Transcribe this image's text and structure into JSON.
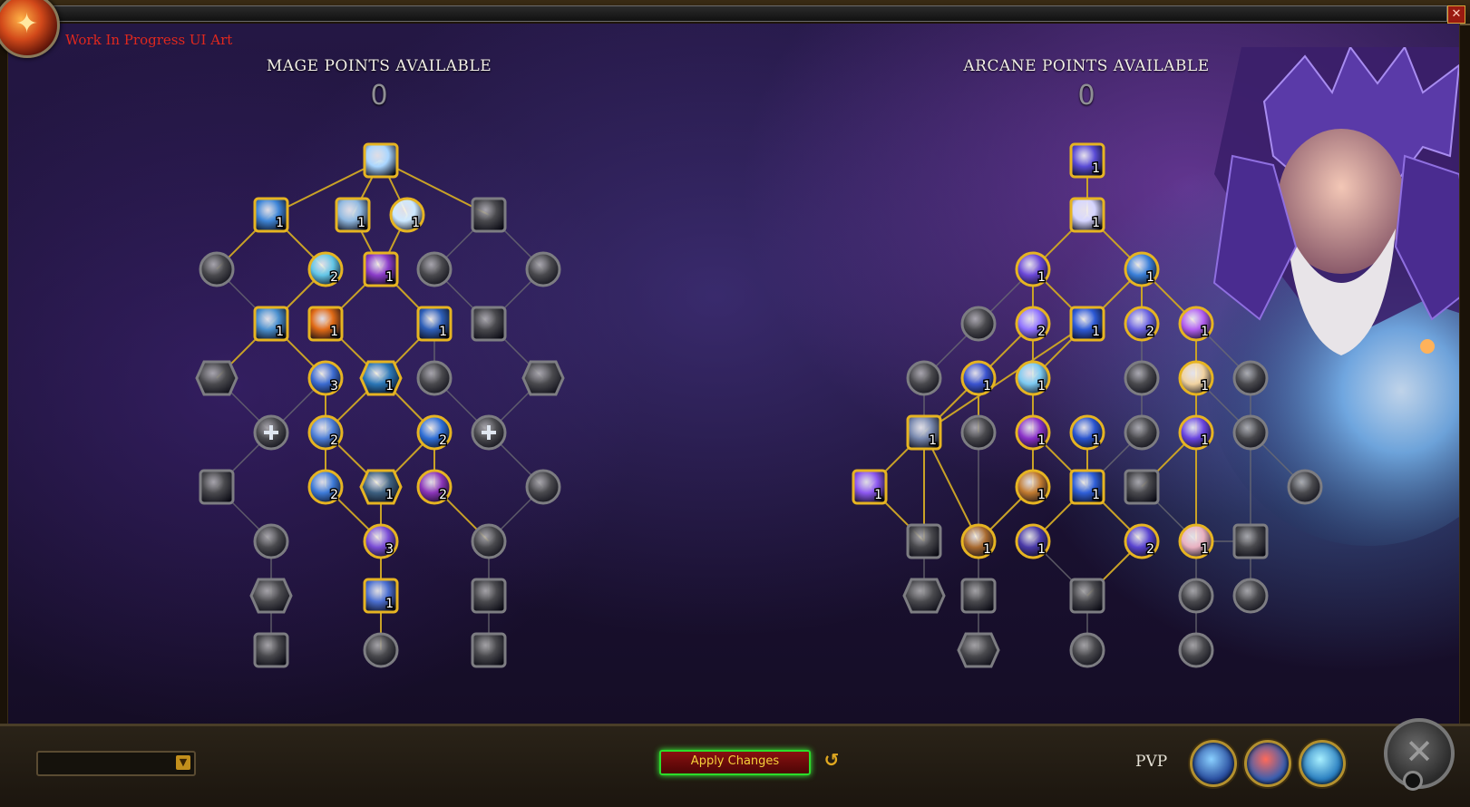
{
  "window": {
    "close_label": "✕"
  },
  "banner": {
    "wip_text": "Work In Progress UI Art"
  },
  "mage_tree": {
    "header": "Mage Points Available",
    "points": "0"
  },
  "arcane_tree": {
    "header": "Arcane Points Available",
    "points": "0"
  },
  "footer": {
    "apply_label": "Apply Changes",
    "undo_icon": "↺",
    "pvp_label": "PVP",
    "loadout_arrow": "▼",
    "close_x": "✕"
  },
  "colors": {
    "gold": "#e6b422",
    "gold_line": "#c9a227",
    "inactive_ring": "#7d7d82",
    "inactive_line": "#6d6d73",
    "points_text": "#8f8f94",
    "wip_red": "#e0281e",
    "apply_glow": "#39ff39"
  },
  "nodes": [
    {
      "id": "m1",
      "shape": "square",
      "active": true,
      "rank": "",
      "icon": "ice-barrier-icon",
      "color": "#a9d6ff"
    },
    {
      "id": "m2",
      "shape": "square",
      "active": true,
      "rank": "1",
      "icon": "ice-shard-icon",
      "color": "#3f86d8"
    },
    {
      "id": "m3",
      "shape": "square",
      "active": true,
      "rank": "1",
      "icon": "frost-armor-icon",
      "color": "#8fb8e0"
    },
    {
      "id": "m4",
      "shape": "circle",
      "active": true,
      "rank": "1",
      "icon": "blink-flash-icon",
      "color": "#cde9ff"
    },
    {
      "id": "m5",
      "shape": "square",
      "active": false,
      "rank": "",
      "icon": "mirror-image-icon",
      "color": "#4aa0b8"
    },
    {
      "id": "m6",
      "shape": "circle",
      "active": false,
      "rank": "",
      "icon": "frost-nova-icon",
      "color": "#5b84c9"
    },
    {
      "id": "m7",
      "shape": "circle",
      "active": true,
      "rank": "2",
      "icon": "time-rune-icon",
      "color": "#62c5e6"
    },
    {
      "id": "m8",
      "shape": "square",
      "active": true,
      "rank": "1",
      "icon": "arcane-shift-icon",
      "color": "#8b3cc9"
    },
    {
      "id": "m9",
      "shape": "circle",
      "active": false,
      "rank": "",
      "icon": "clock-icon",
      "color": "#666"
    },
    {
      "id": "m10",
      "shape": "circle",
      "active": false,
      "rank": "",
      "icon": "dragon-breath-icon",
      "color": "#555"
    },
    {
      "id": "m11",
      "shape": "square",
      "active": true,
      "rank": "1",
      "icon": "frost-giant-icon",
      "color": "#4a90cf"
    },
    {
      "id": "m12",
      "shape": "square",
      "active": true,
      "rank": "1",
      "icon": "fire-ward-icon",
      "color": "#e06a16"
    },
    {
      "id": "m13",
      "shape": "square",
      "active": true,
      "rank": "1",
      "icon": "ice-cold-icon",
      "color": "#2e5fb8"
    },
    {
      "id": "m14",
      "shape": "square",
      "active": false,
      "rank": "",
      "icon": "spellsteal-icon",
      "color": "#777"
    },
    {
      "id": "m15",
      "shape": "choice",
      "active": false,
      "rank": "",
      "icon": "incantation-icon",
      "color": "#5a6a9a"
    },
    {
      "id": "m16",
      "shape": "circle",
      "active": true,
      "rank": "3",
      "icon": "frigid-winds-icon",
      "color": "#3b6bd0"
    },
    {
      "id": "m17",
      "shape": "choice",
      "active": true,
      "rank": "1",
      "icon": "ice-floes-icon",
      "color": "#2a76b6"
    },
    {
      "id": "m18",
      "shape": "circle",
      "active": false,
      "rank": "",
      "icon": "tempest-barrier-icon",
      "color": "#666"
    },
    {
      "id": "m19",
      "shape": "choice",
      "active": false,
      "rank": "",
      "icon": "ring-of-frost-icon",
      "color": "#666"
    },
    {
      "id": "m20",
      "shape": "circle",
      "active": false,
      "rank": "",
      "icon": "plus-icon",
      "color": "#5a7ba6"
    },
    {
      "id": "m21",
      "shape": "circle",
      "active": true,
      "rank": "2",
      "icon": "ice-ward-icon",
      "color": "#4d7fd8"
    },
    {
      "id": "m22",
      "shape": "circle",
      "active": true,
      "rank": "2",
      "icon": "cold-snap-icon",
      "color": "#2f6fd6"
    },
    {
      "id": "m23",
      "shape": "circle",
      "active": false,
      "rank": "",
      "icon": "plus-icon",
      "color": "#777"
    },
    {
      "id": "m24",
      "shape": "square",
      "active": false,
      "rank": "",
      "icon": "slow-icon",
      "color": "#666"
    },
    {
      "id": "m25",
      "shape": "circle",
      "active": true,
      "rank": "2",
      "icon": "winters-protection-icon",
      "color": "#3d7ad8"
    },
    {
      "id": "m26",
      "shape": "choice",
      "active": true,
      "rank": "1",
      "icon": "shifting-power-icon",
      "color": "#3c5f7f"
    },
    {
      "id": "m27",
      "shape": "circle",
      "active": true,
      "rank": "2",
      "icon": "overflowing-energy-icon",
      "color": "#8a34b8"
    },
    {
      "id": "m28",
      "shape": "circle",
      "active": false,
      "rank": "",
      "icon": "rune-of-power-icon",
      "color": "#666"
    },
    {
      "id": "m29",
      "shape": "circle",
      "active": false,
      "rank": "",
      "icon": "frozen-touch-icon",
      "color": "#5fa1c9"
    },
    {
      "id": "m30",
      "shape": "circle",
      "active": true,
      "rank": "3",
      "icon": "arcane-orb-icon",
      "color": "#7a4dd6"
    },
    {
      "id": "m31",
      "shape": "circle",
      "active": false,
      "rank": "",
      "icon": "displacement-icon",
      "color": "#7c4dbb"
    },
    {
      "id": "m32",
      "shape": "choice",
      "active": false,
      "rank": "",
      "icon": "greater-invisibility-icon",
      "color": "#666"
    },
    {
      "id": "m33",
      "shape": "square",
      "active": true,
      "rank": "1",
      "icon": "temporal-warp-icon",
      "color": "#4b6fd0"
    },
    {
      "id": "m34",
      "shape": "square",
      "active": false,
      "rank": "",
      "icon": "dragons-breath-icon",
      "color": "#666"
    },
    {
      "id": "m35",
      "shape": "square",
      "active": false,
      "rank": "",
      "icon": "freezing-cold-icon",
      "color": "#777"
    },
    {
      "id": "m36",
      "shape": "circle",
      "active": false,
      "rank": "",
      "icon": "time-manipulation-icon",
      "color": "#7c3fb0"
    },
    {
      "id": "m37",
      "shape": "square",
      "active": false,
      "rank": "",
      "icon": "meteor-icon",
      "color": "#777"
    },
    {
      "id": "a1",
      "shape": "square",
      "active": true,
      "rank": "1",
      "icon": "arcane-missile-icon",
      "color": "#5a4cd6"
    },
    {
      "id": "a2",
      "shape": "square",
      "active": true,
      "rank": "1",
      "icon": "arcane-explosion-icon",
      "color": "#d5d5ff"
    },
    {
      "id": "a3",
      "shape": "circle",
      "active": true,
      "rank": "1",
      "icon": "arcane-surge-icon",
      "color": "#6b48d8"
    },
    {
      "id": "a4",
      "shape": "circle",
      "active": true,
      "rank": "1",
      "icon": "evocation-icon",
      "color": "#3a7fd8"
    },
    {
      "id": "a5",
      "shape": "circle",
      "active": false,
      "rank": "",
      "icon": "nether-tempest-icon",
      "color": "#5b3fa5"
    },
    {
      "id": "a6",
      "shape": "circle",
      "active": true,
      "rank": "2",
      "icon": "arcane-echo-icon",
      "color": "#8f72ff"
    },
    {
      "id": "a7",
      "shape": "square",
      "active": true,
      "rank": "1",
      "icon": "arcane-lightning-icon",
      "color": "#2d5ad6"
    },
    {
      "id": "a8",
      "shape": "circle",
      "active": true,
      "rank": "2",
      "icon": "arcane-harmony-icon",
      "color": "#6b63e0"
    },
    {
      "id": "a9",
      "shape": "circle",
      "active": true,
      "rank": "1",
      "icon": "arcane-bombardment-icon",
      "color": "#b25ef0"
    },
    {
      "id": "a10",
      "shape": "circle",
      "active": false,
      "rank": "",
      "icon": "boot-icon",
      "color": "#666"
    },
    {
      "id": "a11",
      "shape": "circle",
      "active": true,
      "rank": "1",
      "icon": "arcane-tempo-icon",
      "color": "#3a53cf"
    },
    {
      "id": "a12",
      "shape": "circle",
      "active": true,
      "rank": "1",
      "icon": "arcane-familiar-icon",
      "color": "#7cc9f0"
    },
    {
      "id": "a13",
      "shape": "circle",
      "active": false,
      "rank": "",
      "icon": "chrono-shift-icon",
      "color": "#3f5fd0"
    },
    {
      "id": "a14",
      "shape": "circle",
      "active": true,
      "rank": "1",
      "icon": "touch-of-magi-icon",
      "color": "#f0d2a0"
    },
    {
      "id": "a15",
      "shape": "circle",
      "active": false,
      "rank": "",
      "icon": "arcane-barrage-icon",
      "color": "#7a5cf0"
    },
    {
      "id": "a16",
      "shape": "square",
      "active": true,
      "rank": "1",
      "icon": "mana-shield-icon",
      "color": "#7a8ab0"
    },
    {
      "id": "a17",
      "shape": "circle",
      "active": false,
      "rank": "",
      "icon": "supernova-icon",
      "color": "#a05cd0"
    },
    {
      "id": "a18",
      "shape": "circle",
      "active": true,
      "rank": "1",
      "icon": "presence-of-mind-icon",
      "color": "#8a32c8"
    },
    {
      "id": "a19",
      "shape": "circle",
      "active": true,
      "rank": "1",
      "icon": "impetus-icon",
      "color": "#2a55cf"
    },
    {
      "id": "a20",
      "shape": "circle",
      "active": false,
      "rank": "",
      "icon": "cyclone-icon",
      "color": "#666"
    },
    {
      "id": "a21",
      "shape": "circle",
      "active": true,
      "rank": "1",
      "icon": "resonance-icon",
      "color": "#6a46e0"
    },
    {
      "id": "a22",
      "shape": "circle",
      "active": false,
      "rank": "",
      "icon": "orb-barrage-icon",
      "color": "#2e5d9e"
    },
    {
      "id": "a23",
      "shape": "square",
      "active": true,
      "rank": "1",
      "icon": "arcane-power-icon",
      "color": "#8d58f0"
    },
    {
      "id": "a24",
      "shape": "circle",
      "active": true,
      "rank": "1",
      "icon": "prodigious-savant-icon",
      "color": "#c07a30"
    },
    {
      "id": "a25",
      "shape": "square",
      "active": true,
      "rank": "1",
      "icon": "static-charge-icon",
      "color": "#2f5fd8"
    },
    {
      "id": "a26",
      "shape": "square",
      "active": false,
      "rank": "",
      "icon": "arcane-ward-icon",
      "color": "#6a4ad0"
    },
    {
      "id": "a27",
      "shape": "circle",
      "active": false,
      "rank": "",
      "icon": "star-flare-icon",
      "color": "#ddd"
    },
    {
      "id": "a28",
      "shape": "square",
      "active": false,
      "rank": "",
      "icon": "arcing-cleave-icon",
      "color": "#666"
    },
    {
      "id": "a29",
      "shape": "circle",
      "active": true,
      "rank": "1",
      "icon": "enlightened-icon",
      "color": "#a86a30"
    },
    {
      "id": "a30",
      "shape": "circle",
      "active": true,
      "rank": "1",
      "icon": "arcane-debilitation-icon",
      "color": "#4a3aa8"
    },
    {
      "id": "a31",
      "shape": "circle",
      "active": true,
      "rank": "2",
      "icon": "siphon-storm-icon",
      "color": "#5a44d0"
    },
    {
      "id": "a32",
      "shape": "circle",
      "active": true,
      "rank": "1",
      "icon": "illuminated-thoughts-icon",
      "color": "#e8b0c0"
    },
    {
      "id": "a33",
      "shape": "square",
      "active": false,
      "rank": "",
      "icon": "foresight-icon",
      "color": "#777"
    },
    {
      "id": "a34",
      "shape": "choice",
      "active": false,
      "rank": "",
      "icon": "concentration-icon",
      "color": "#666"
    },
    {
      "id": "a35",
      "shape": "square",
      "active": false,
      "rank": "",
      "icon": "orb-mastery-icon",
      "color": "#777"
    },
    {
      "id": "a36",
      "shape": "square",
      "active": false,
      "rank": "",
      "icon": "arcane-focus-icon",
      "color": "#5aa0d0"
    },
    {
      "id": "a37",
      "shape": "circle",
      "active": false,
      "rank": "",
      "icon": "radiant-spark-icon",
      "color": "#777"
    },
    {
      "id": "a38",
      "shape": "circle",
      "active": false,
      "rank": "",
      "icon": "harmonic-echo-icon",
      "color": "#777"
    },
    {
      "id": "a39",
      "shape": "choice",
      "active": false,
      "rank": "",
      "icon": "time-anomaly-icon",
      "color": "#666"
    },
    {
      "id": "a40",
      "shape": "circle",
      "active": false,
      "rank": "",
      "icon": "arcane-infinity-icon",
      "color": "#777"
    },
    {
      "id": "a41",
      "shape": "circle",
      "active": false,
      "rank": "",
      "icon": "spiral-icon",
      "color": "#777"
    }
  ],
  "edges": [
    [
      "m1",
      "m2",
      true
    ],
    [
      "m1",
      "m3",
      true
    ],
    [
      "m1",
      "m4",
      true
    ],
    [
      "m1",
      "m5",
      true
    ],
    [
      "m2",
      "m6",
      true
    ],
    [
      "m2",
      "m7",
      true
    ],
    [
      "m4",
      "m8",
      true
    ],
    [
      "m3",
      "m8",
      true
    ],
    [
      "m5",
      "m9",
      false
    ],
    [
      "m5",
      "m10",
      false
    ],
    [
      "m6",
      "m11",
      false
    ],
    [
      "m7",
      "m11",
      true
    ],
    [
      "m8",
      "m12",
      true
    ],
    [
      "m8",
      "m13",
      true
    ],
    [
      "m9",
      "m14",
      false
    ],
    [
      "m10",
      "m14",
      false
    ],
    [
      "m11",
      "m15",
      true
    ],
    [
      "m11",
      "m16",
      true
    ],
    [
      "m12",
      "m17",
      true
    ],
    [
      "m13",
      "m17",
      true
    ],
    [
      "m13",
      "m18",
      false
    ],
    [
      "m14",
      "m19",
      false
    ],
    [
      "m15",
      "m20",
      false
    ],
    [
      "m16",
      "m20",
      false
    ],
    [
      "m16",
      "m21",
      true
    ],
    [
      "m17",
      "m21",
      true
    ],
    [
      "m17",
      "m22",
      true
    ],
    [
      "m18",
      "m23",
      false
    ],
    [
      "m19",
      "m23",
      false
    ],
    [
      "m20",
      "m24",
      false
    ],
    [
      "m21",
      "m25",
      true
    ],
    [
      "m21",
      "m26",
      true
    ],
    [
      "m22",
      "m26",
      true
    ],
    [
      "m22",
      "m27",
      true
    ],
    [
      "m23",
      "m28",
      false
    ],
    [
      "m24",
      "m29",
      false
    ],
    [
      "m25",
      "m30",
      true
    ],
    [
      "m26",
      "m30",
      true
    ],
    [
      "m27",
      "m31",
      true
    ],
    [
      "m28",
      "m31",
      false
    ],
    [
      "m29",
      "m32",
      false
    ],
    [
      "m30",
      "m33",
      true
    ],
    [
      "m31",
      "m34",
      false
    ],
    [
      "m32",
      "m35",
      false
    ],
    [
      "m33",
      "m36",
      true
    ],
    [
      "m34",
      "m37",
      false
    ],
    [
      "a1",
      "a2",
      true
    ],
    [
      "a2",
      "a3",
      true
    ],
    [
      "a2",
      "a4",
      true
    ],
    [
      "a3",
      "a5",
      false
    ],
    [
      "a3",
      "a6",
      true
    ],
    [
      "a3",
      "a7",
      true
    ],
    [
      "a4",
      "a7",
      true
    ],
    [
      "a4",
      "a8",
      true
    ],
    [
      "a4",
      "a9",
      true
    ],
    [
      "a5",
      "a10",
      false
    ],
    [
      "a6",
      "a11",
      true
    ],
    [
      "a6",
      "a12",
      true
    ],
    [
      "a7",
      "a12",
      true
    ],
    [
      "a7",
      "a16",
      true
    ],
    [
      "a8",
      "a13",
      false
    ],
    [
      "a9",
      "a14",
      true
    ],
    [
      "a9",
      "a15",
      false
    ],
    [
      "a11",
      "a16",
      true
    ],
    [
      "a11",
      "a17",
      true
    ],
    [
      "a12",
      "a18",
      true
    ],
    [
      "a13",
      "a20",
      false
    ],
    [
      "a14",
      "a21",
      true
    ],
    [
      "a14",
      "a22",
      false
    ],
    [
      "a10",
      "a16",
      false
    ],
    [
      "a16",
      "a23",
      true
    ],
    [
      "a16",
      "a28",
      true
    ],
    [
      "a16",
      "a29",
      true
    ],
    [
      "a17",
      "a29",
      false
    ],
    [
      "a18",
      "a24",
      true
    ],
    [
      "a18",
      "a25",
      true
    ],
    [
      "a19",
      "a25",
      true
    ],
    [
      "a20",
      "a25",
      false
    ],
    [
      "a21",
      "a26",
      true
    ],
    [
      "a21",
      "a32",
      true
    ],
    [
      "a22",
      "a27",
      false
    ],
    [
      "a22",
      "a33",
      false
    ],
    [
      "a15",
      "a22",
      false
    ],
    [
      "a23",
      "a28",
      true
    ],
    [
      "a24",
      "a29",
      true
    ],
    [
      "a25",
      "a30",
      true
    ],
    [
      "a25",
      "a31",
      true
    ],
    [
      "a26",
      "a32",
      false
    ],
    [
      "a32",
      "a33",
      false
    ],
    [
      "a28",
      "a34",
      false
    ],
    [
      "a29",
      "a35",
      false
    ],
    [
      "a30",
      "a36",
      false
    ],
    [
      "a31",
      "a36",
      true
    ],
    [
      "a32",
      "a37",
      false
    ],
    [
      "a33",
      "a38",
      false
    ],
    [
      "a35",
      "a39",
      false
    ],
    [
      "a36",
      "a40",
      false
    ],
    [
      "a37",
      "a41",
      false
    ]
  ]
}
